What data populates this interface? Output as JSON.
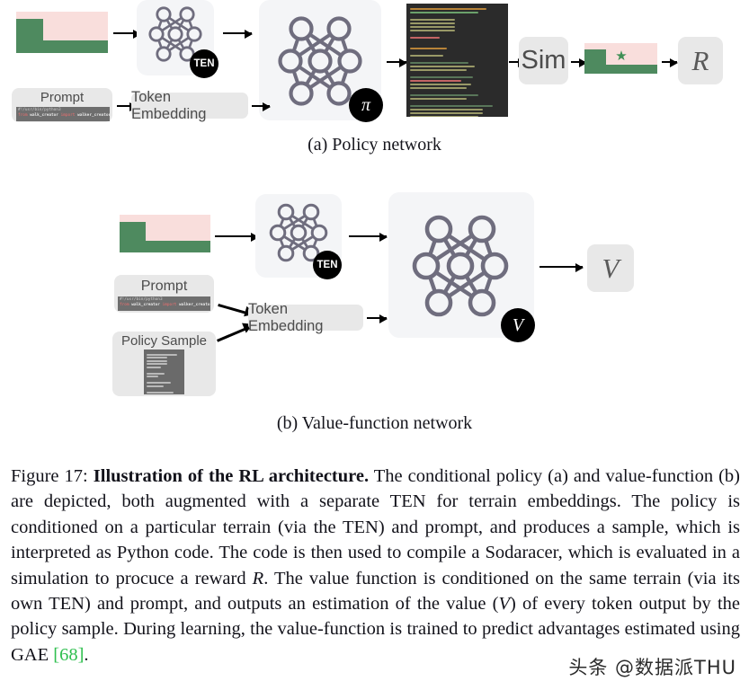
{
  "figure": {
    "label": "Figure 17:",
    "title": "Illustration of the RL architecture.",
    "body_1": " The conditional policy (a) and value-function (b) are depicted, both augmented with a separate TEN for terrain embeddings.  The policy is conditioned on a particular terrain (via the TEN) and prompt, and produces a sample, which is interpreted as Python code. The code is then used to compile a Sodaracer, which is evaluated in a simulation to procuce a reward ",
    "reward_symbol": "R",
    "body_2": ". The value function is conditioned on the same terrain (via its own TEN) and prompt, and outputs an estimation of the value (",
    "value_symbol": "V",
    "body_3": ") of every token output by the policy sample. During learning, the value-function is trained to predict advantages estimated using GAE ",
    "citation": "[68]",
    "body_4": ".",
    "watermark": "头条 @数据派THU"
  },
  "panel_a": {
    "subcaption": "(a) Policy network",
    "ten_badge": "TEN",
    "policy_badge": "π",
    "prompt_label": "Prompt",
    "prompt_code_line_1": "#!/usr/bin/python3",
    "prompt_code_line_2_kw": "from",
    "prompt_code_line_2_mod": " walk_creator ",
    "prompt_code_line_2_kw2": "import",
    "prompt_code_line_2_id": " walker_creator",
    "token_embedding_label": "Token Embedding",
    "sim_label": "Sim",
    "reward_label": "R",
    "terrain_name": "terrain-thumbnail",
    "sim_terrain_name": "simulated-terrain-thumbnail",
    "code_name": "generated-python-code"
  },
  "panel_b": {
    "subcaption": "(b) Value-function network",
    "ten_badge": "TEN",
    "value_badge": "V",
    "prompt_label": "Prompt",
    "prompt_code_line_1": "#!/usr/bin/python3",
    "prompt_code_line_2_kw": "from",
    "prompt_code_line_2_mod": " walk_creator ",
    "prompt_code_line_2_kw2": "import",
    "prompt_code_line_2_id": " walker_creator",
    "policy_sample_label": "Policy Sample",
    "token_embedding_label": "Token Embedding",
    "value_label": "V"
  },
  "colors": {
    "terrain_sky": "#f9dedc",
    "terrain_ground": "#4e8a5f",
    "panel_bg": "#f4f5f7",
    "box_bg": "#e8e8e8",
    "network_stroke": "#6f6d7e",
    "badge_bg": "#000000",
    "citation_green": "#2fbf4f"
  }
}
